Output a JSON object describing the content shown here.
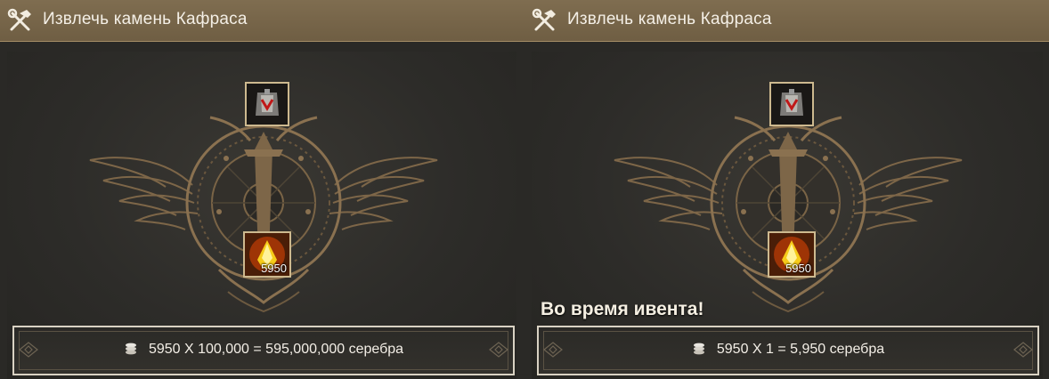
{
  "panels": [
    {
      "title": "Извлечь камень Кафраса",
      "top_item_icon": "armor-chest-icon",
      "bottom_item_icon": "black-stone-icon",
      "stone_count": "5950",
      "event_label": "",
      "formula": "5950 X 100,000 = 595,000,000 серебра"
    },
    {
      "title": "Извлечь камень Кафраса",
      "top_item_icon": "armor-chest-icon",
      "bottom_item_icon": "black-stone-icon",
      "stone_count": "5950",
      "event_label": "Во время ивента!",
      "formula": "5950 X 1 = 5,950 серебра"
    }
  ],
  "colors": {
    "header_bg": "#766549",
    "panel_bg": "#2a2926",
    "accent_gold": "#cdb98f",
    "emblem_bronze": "#8a7150"
  }
}
